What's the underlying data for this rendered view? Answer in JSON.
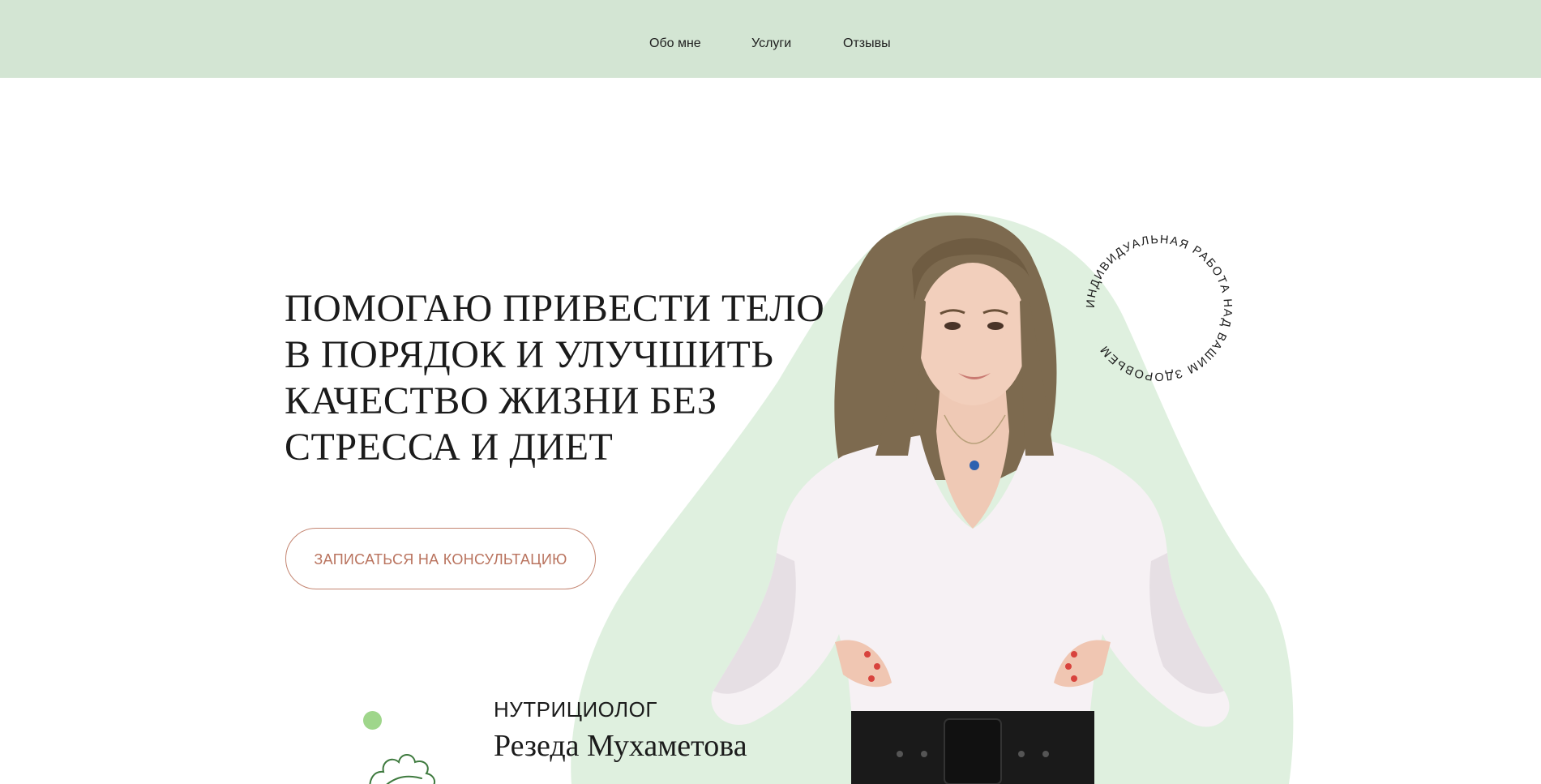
{
  "nav": {
    "items": [
      "Обо мне",
      "Услуги",
      "Отзывы"
    ]
  },
  "hero": {
    "headline_lines": [
      "ПОМОГАЮ ПРИВЕСТИ ТЕЛО",
      "В ПОРЯДОК И УЛУЧШИТЬ",
      "КАЧЕСТВО ЖИЗНИ БЕЗ",
      "СТРЕССА И ДИЕТ"
    ],
    "cta_label": "ЗАПИСАТЬСЯ НА КОНСУЛЬТАЦИЮ",
    "role": "НУТРИЦИОЛОГ",
    "name": "Резеда Мухаметова",
    "circle_text": "ИНДИВИДУАЛЬНАЯ РАБОТА НАД ВАШИМ ЗДОРОВЬЕМ"
  },
  "colors": {
    "header_bg": "#d3e5d3",
    "blob": "#dff0df",
    "cta_accent": "#c48571",
    "dot": "#9fd68b",
    "leaf_stroke": "#3e7a3e"
  }
}
